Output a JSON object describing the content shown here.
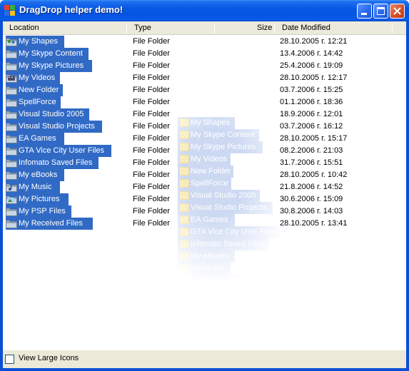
{
  "window": {
    "title": "DragDrop helper demo!"
  },
  "columns": {
    "location": "Location",
    "type": "Type",
    "size": "Size",
    "date": "Date Modified"
  },
  "rows": [
    {
      "name": "My Shapes",
      "type": "File Folder",
      "date": "28.10.2005 г. 12:21",
      "icon": "shapes-folder-icon"
    },
    {
      "name": "My Skype Content",
      "type": "File Folder",
      "date": "13.4.2006 г. 14:42",
      "icon": "folder-icon"
    },
    {
      "name": "My Skype Pictures",
      "type": "File Folder",
      "date": "25.4.2006 г. 19:09",
      "icon": "folder-icon"
    },
    {
      "name": "My Videos",
      "type": "File Folder",
      "date": "28.10.2005 г. 12:17",
      "icon": "videos-folder-icon"
    },
    {
      "name": "New Folder",
      "type": "File Folder",
      "date": "03.7.2006 г. 15:25",
      "icon": "folder-icon"
    },
    {
      "name": "SpellForce",
      "type": "File Folder",
      "date": "01.1.2006 г. 18:36",
      "icon": "folder-icon"
    },
    {
      "name": "Visual Studio 2005",
      "type": "File Folder",
      "date": "18.9.2006 г. 12:01",
      "icon": "folder-icon"
    },
    {
      "name": "Visual Studio Projects",
      "type": "File Folder",
      "date": "03.7.2006 г. 16:12",
      "icon": "folder-icon"
    },
    {
      "name": "EA Games",
      "type": "File Folder",
      "date": "28.10.2005 г. 15:17",
      "icon": "folder-icon"
    },
    {
      "name": "GTA Vice City User Files",
      "type": "File Folder",
      "date": "08.2.2006 г. 21:03",
      "icon": "folder-icon"
    },
    {
      "name": "Infomato Saved Files",
      "type": "File Folder",
      "date": "31.7.2006 г. 15:51",
      "icon": "folder-icon"
    },
    {
      "name": "My eBooks",
      "type": "File Folder",
      "date": "28.10.2005 г. 10:42",
      "icon": "folder-icon"
    },
    {
      "name": "My Music",
      "type": "File Folder",
      "date": "21.8.2006 г. 14:52",
      "icon": "music-folder-icon"
    },
    {
      "name": "My Pictures",
      "type": "File Folder",
      "date": "30.6.2006 г. 15:09",
      "icon": "pictures-folder-icon"
    },
    {
      "name": "My PSP Files",
      "type": "File Folder",
      "date": "30.8.2006 г. 14:03",
      "icon": "folder-icon"
    },
    {
      "name": "My Received Files",
      "type": "File Folder",
      "date": "28.10.2005 г. 13:41",
      "icon": "folder-icon"
    }
  ],
  "drag_ghost": {
    "items": [
      "My Shapes",
      "My Skype Content",
      "My Skype Pictures",
      "My Videos",
      "New Folder",
      "SpellForce",
      "Visual Studio 2005",
      "Visual Studio Projects",
      "EA Games",
      "GTA Vice City User Files",
      "Infomato Saved Files",
      "My eBooks",
      "My Music",
      "My Pictures",
      "My PSP Files"
    ]
  },
  "options": {
    "large_icons_label": "View Large Icons",
    "large_icons_checked": false
  },
  "colors": {
    "selection": "#316ac5",
    "titlebar": "#0554e3",
    "face": "#ece9d8"
  }
}
